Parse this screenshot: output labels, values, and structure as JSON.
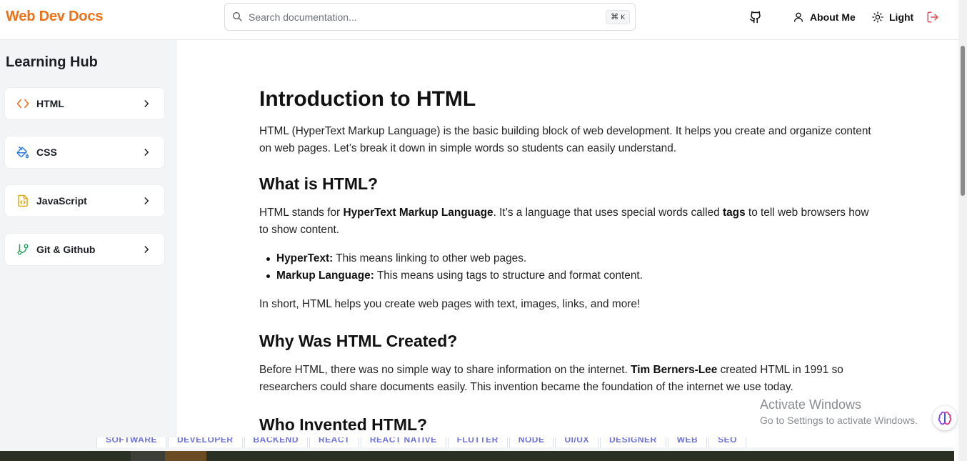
{
  "header": {
    "brand": "Web Dev Docs",
    "search_placeholder": "Search documentation...",
    "shortcut_symbol": "⌘",
    "shortcut_key": "K",
    "about_label": "About Me",
    "theme_label": "Light"
  },
  "sidebar": {
    "title": "Learning Hub",
    "items": [
      {
        "label": "HTML",
        "icon": "code-icon",
        "color": "#f07016"
      },
      {
        "label": "CSS",
        "icon": "paint-bucket-icon",
        "color": "#2f7de1"
      },
      {
        "label": "JavaScript",
        "icon": "file-code-icon",
        "color": "#e0a70f"
      },
      {
        "label": "Git & Github",
        "icon": "git-branch-icon",
        "color": "#22a45d"
      }
    ]
  },
  "content": {
    "title": "Introduction to HTML",
    "intro": "HTML (HyperText Markup Language) is the basic building block of web development. It helps you create and organize content on web pages. Let’s break it down in simple words so students can easily understand.",
    "what_heading": "What is HTML?",
    "what_text_1": "HTML stands for ",
    "what_bold_1": "HyperText Markup Language",
    "what_text_2": ". It’s a language that uses special words called ",
    "what_bold_2": "tags",
    "what_text_3": " to tell web browsers how to show content.",
    "bullets": [
      {
        "term": "HyperText:",
        "text": " This means linking to other web pages."
      },
      {
        "term": "Markup Language:",
        "text": " This means using tags to structure and format content."
      }
    ],
    "summary": "In short, HTML helps you create web pages with text, images, links, and more!",
    "why_heading": "Why Was HTML Created?",
    "why_text_1": "Before HTML, there was no simple way to share information on the internet. ",
    "why_bold": "Tim Berners-Lee",
    "why_text_2": " created HTML in 1991 so researchers could share documents easily. This invention became the foundation of the internet we use today.",
    "who_heading": "Who Invented HTML?"
  },
  "tags": [
    "SOFTWARE",
    "DEVELOPER",
    "BACKEND",
    "REACT",
    "REACT NATIVE",
    "FLUTTER",
    "NODE",
    "UI/UX",
    "DESIGNER",
    "WEB",
    "SEO"
  ],
  "watermark": {
    "line1": "Activate Windows",
    "line2": "Go to Settings to activate Windows."
  },
  "colors": {
    "brand": "#f07016",
    "logout": "#e5484d",
    "tag_text": "#6d6fd8"
  }
}
